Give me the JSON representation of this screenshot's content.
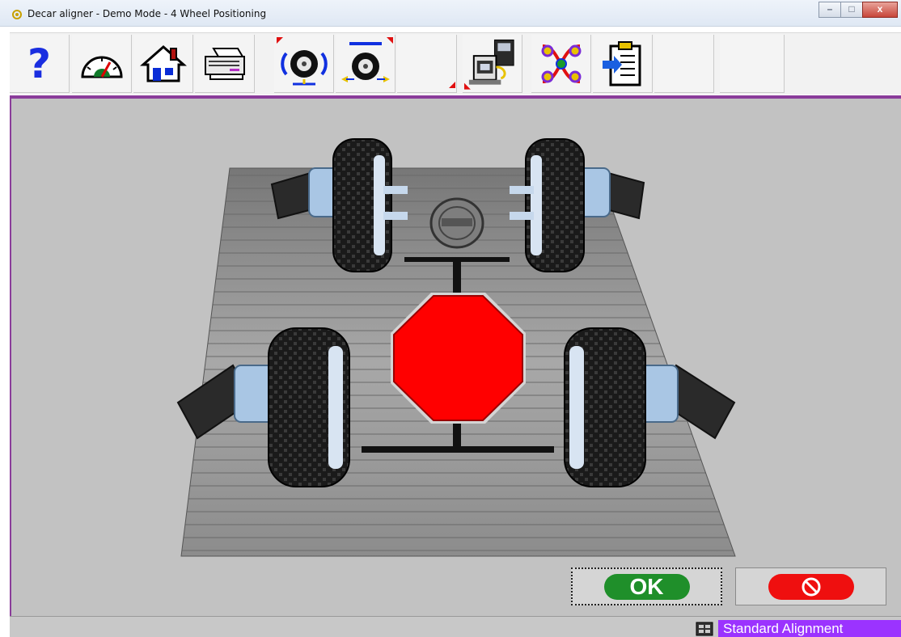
{
  "window": {
    "title": "Decar aligner - Demo Mode  -  4 Wheel Positioning",
    "controls": {
      "minimize": "–",
      "maximize": "□",
      "close": "x"
    }
  },
  "toolbar": {
    "buttons": [
      {
        "name": "help",
        "icon": "question-mark-icon"
      },
      {
        "name": "gauge",
        "icon": "gauge-icon"
      },
      {
        "name": "home",
        "icon": "house-icon"
      },
      {
        "name": "print",
        "icon": "printer-icon"
      },
      {
        "name": "wheel-front",
        "icon": "wheel-rotate-icon"
      },
      {
        "name": "wheel-rear",
        "icon": "wheel-compensate-icon"
      },
      {
        "name": "empty-1",
        "icon": ""
      },
      {
        "name": "machine",
        "icon": "machine-icon"
      },
      {
        "name": "pattern",
        "icon": "pattern-icon"
      },
      {
        "name": "clipboard",
        "icon": "clipboard-icon"
      },
      {
        "name": "empty-2",
        "icon": ""
      },
      {
        "name": "empty-3",
        "icon": ""
      }
    ],
    "help_label": "?"
  },
  "stage": {
    "scene": "4 wheel positioning",
    "wheels": [
      "front-left",
      "front-right",
      "rear-left",
      "rear-right"
    ],
    "stop_color": "#ff0000"
  },
  "actions": {
    "ok_label": "OK",
    "cancel_icon": "no-entry-icon",
    "ok_color": "#1f8f2a",
    "cancel_color": "#ef0f0f"
  },
  "status": {
    "mode": "Standard Alignment",
    "color": "#9b33ff"
  }
}
